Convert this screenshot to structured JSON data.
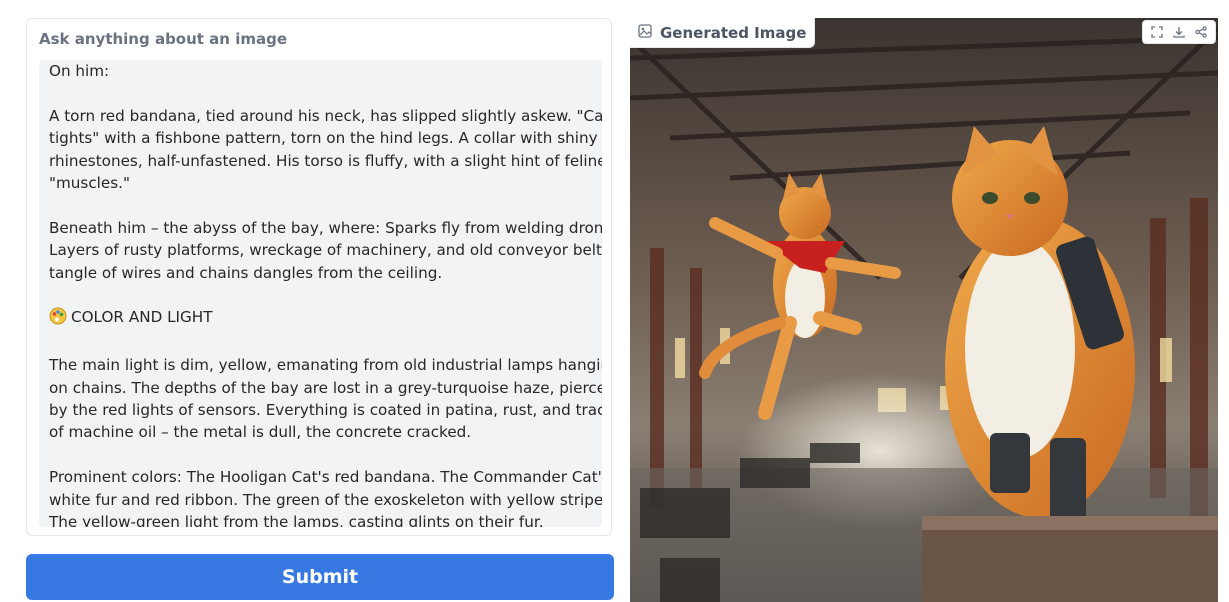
{
  "prompt_panel": {
    "label": "Ask anything about an image",
    "lines": [
      "On him:",
      "",
      "A torn red bandana, tied around his neck, has slipped slightly askew. \"Cat",
      "tights\" with a fishbone pattern, torn on the hind legs. A collar with shiny",
      "rhinestones, half-unfastened. His torso is fluffy, with a slight hint of feline",
      "\"muscles.\"",
      "",
      "Beneath him – the abyss of the bay, where: Sparks fly from welding drones.",
      "Layers of rusty platforms, wreckage of machinery, and old conveyor belts. A",
      "tangle of wires and chains dangles from the ceiling.",
      "",
      "COLOR AND LIGHT",
      "",
      "The main light is dim, yellow, emanating from old industrial lamps hanging",
      "on chains. The depths of the bay are lost in a grey-turquoise haze, pierced",
      "by the red lights of sensors. Everything is coated in patina, rust, and traces",
      "of machine oil – the metal is dull, the concrete cracked.",
      "",
      "Prominent colors: The Hooligan Cat's red bandana. The Commander Cat's",
      "white fur and red ribbon. The green of the exoskeleton with yellow stripes.",
      "The yellow-green light from the lamps, casting glints on their fur."
    ],
    "emoji_line_index": 11,
    "emoji_icon": "palette-emoji-icon"
  },
  "submit": {
    "label": "Submit",
    "color": "#3778e3"
  },
  "output_panel": {
    "label": "Generated Image",
    "tools": [
      "fullscreen-icon",
      "download-icon",
      "share-icon"
    ]
  }
}
